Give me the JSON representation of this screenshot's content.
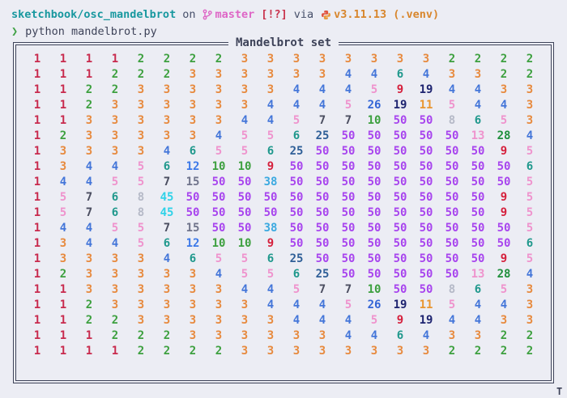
{
  "prompt": {
    "path": "sketchbook/osc_mandelbrot",
    "on": "on",
    "branch": "master",
    "git_status": "[!?]",
    "via": "via",
    "python_version": "v3.11.13",
    "venv": "(.venv)",
    "prompt_char": "❯",
    "command": "python mandelbrot.py"
  },
  "panel": {
    "title": "Mandelbrot set"
  },
  "grid": {
    "rows": [
      [
        1,
        1,
        1,
        1,
        2,
        2,
        2,
        2,
        3,
        3,
        3,
        3,
        3,
        3,
        3,
        3,
        2,
        2,
        2,
        2
      ],
      [
        1,
        1,
        1,
        2,
        2,
        2,
        3,
        3,
        3,
        3,
        3,
        3,
        4,
        4,
        6,
        4,
        3,
        3,
        2,
        2
      ],
      [
        1,
        1,
        2,
        2,
        3,
        3,
        3,
        3,
        3,
        3,
        4,
        4,
        4,
        5,
        9,
        19,
        4,
        4,
        3,
        3
      ],
      [
        1,
        1,
        2,
        3,
        3,
        3,
        3,
        3,
        3,
        4,
        4,
        4,
        5,
        26,
        19,
        11,
        5,
        4,
        4,
        3
      ],
      [
        1,
        1,
        3,
        3,
        3,
        3,
        3,
        3,
        4,
        4,
        5,
        7,
        7,
        10,
        50,
        50,
        8,
        6,
        5,
        3
      ],
      [
        1,
        2,
        3,
        3,
        3,
        3,
        3,
        4,
        5,
        5,
        6,
        25,
        50,
        50,
        50,
        50,
        50,
        13,
        28,
        4
      ],
      [
        1,
        3,
        3,
        3,
        3,
        4,
        6,
        5,
        5,
        6,
        25,
        50,
        50,
        50,
        50,
        50,
        50,
        50,
        9,
        5
      ],
      [
        1,
        3,
        4,
        4,
        5,
        6,
        12,
        10,
        10,
        9,
        50,
        50,
        50,
        50,
        50,
        50,
        50,
        50,
        50,
        6
      ],
      [
        1,
        4,
        4,
        5,
        5,
        7,
        15,
        50,
        50,
        38,
        50,
        50,
        50,
        50,
        50,
        50,
        50,
        50,
        50,
        5
      ],
      [
        1,
        5,
        7,
        6,
        8,
        45,
        50,
        50,
        50,
        50,
        50,
        50,
        50,
        50,
        50,
        50,
        50,
        50,
        9,
        5
      ],
      [
        1,
        5,
        7,
        6,
        8,
        45,
        50,
        50,
        50,
        50,
        50,
        50,
        50,
        50,
        50,
        50,
        50,
        50,
        9,
        5
      ],
      [
        1,
        4,
        4,
        5,
        5,
        7,
        15,
        50,
        50,
        38,
        50,
        50,
        50,
        50,
        50,
        50,
        50,
        50,
        50,
        5
      ],
      [
        1,
        3,
        4,
        4,
        5,
        6,
        12,
        10,
        10,
        9,
        50,
        50,
        50,
        50,
        50,
        50,
        50,
        50,
        50,
        6
      ],
      [
        1,
        3,
        3,
        3,
        3,
        4,
        6,
        5,
        5,
        6,
        25,
        50,
        50,
        50,
        50,
        50,
        50,
        50,
        9,
        5
      ],
      [
        1,
        2,
        3,
        3,
        3,
        3,
        3,
        4,
        5,
        5,
        6,
        25,
        50,
        50,
        50,
        50,
        50,
        13,
        28,
        4
      ],
      [
        1,
        1,
        3,
        3,
        3,
        3,
        3,
        3,
        4,
        4,
        5,
        7,
        7,
        10,
        50,
        50,
        8,
        6,
        5,
        3
      ],
      [
        1,
        1,
        2,
        3,
        3,
        3,
        3,
        3,
        3,
        4,
        4,
        4,
        5,
        26,
        19,
        11,
        5,
        4,
        4,
        3
      ],
      [
        1,
        1,
        2,
        2,
        3,
        3,
        3,
        3,
        3,
        3,
        4,
        4,
        4,
        5,
        9,
        19,
        4,
        4,
        3,
        3
      ],
      [
        1,
        1,
        1,
        2,
        2,
        2,
        3,
        3,
        3,
        3,
        3,
        3,
        4,
        4,
        6,
        4,
        3,
        3,
        2,
        2
      ],
      [
        1,
        1,
        1,
        1,
        2,
        2,
        2,
        2,
        3,
        3,
        3,
        3,
        3,
        3,
        3,
        3,
        2,
        2,
        2,
        2
      ]
    ]
  },
  "value_colors": {
    "1": "#c82a4d",
    "2": "#3da03f",
    "3": "#e78a3e",
    "4": "#4476d9",
    "5": "#ef93cd",
    "6": "#1f988c",
    "7": "#4b4e60",
    "8": "#b5b9c7",
    "9": "#d5203c",
    "10": "#3da03f",
    "11": "#e9952f",
    "12": "#3b78e8",
    "13": "#ef93cd",
    "15": "#70748b",
    "19": "#1e2470",
    "25": "#2e5e97",
    "26": "#3365d6",
    "28": "#1f8f3c",
    "38": "#3ba9e0",
    "45": "#30d2e8",
    "50": "#a845ee"
  },
  "colors": {
    "background": "#ecedf4",
    "border": "#3e4359",
    "path_teal": "#18989f",
    "branch_pink": "#de66c6",
    "status_red": "#c9344e",
    "version_orange": "#d8862c",
    "prompt_green": "#3fa144",
    "text_dark": "#3e4359"
  },
  "artifact": "T"
}
